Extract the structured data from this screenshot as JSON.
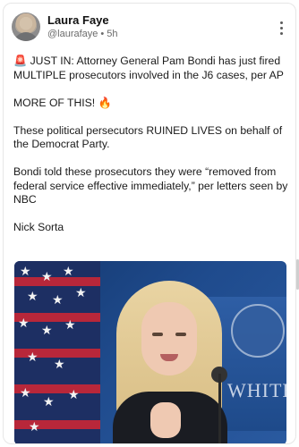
{
  "author": {
    "name": "Laura Faye",
    "handle": "@laurafaye",
    "time": "5h"
  },
  "post": {
    "paragraphs": [
      {
        "siren": "🚨",
        "text": " JUST IN: Attorney General Pam Bondi has just fired MULTIPLE prosecutors involved in the J6 cases, per AP"
      },
      {
        "text": "MORE OF THIS! 🔥"
      },
      {
        "text": "These political persecutors RUINED LIVES on behalf of the Democrat Party."
      },
      {
        "text": "Bondi told these prosecutors they were “removed from federal service effective immediately,” per letters seen by NBC"
      },
      {
        "text": "Nick Sorta"
      }
    ]
  },
  "image": {
    "banner_text": "WHITE"
  },
  "icons": {
    "more": "more-vertical-icon"
  },
  "colors": {
    "accent_red": "#b8273a",
    "flag_blue": "#1d2f63",
    "background_blue": "#1f4b8d"
  }
}
